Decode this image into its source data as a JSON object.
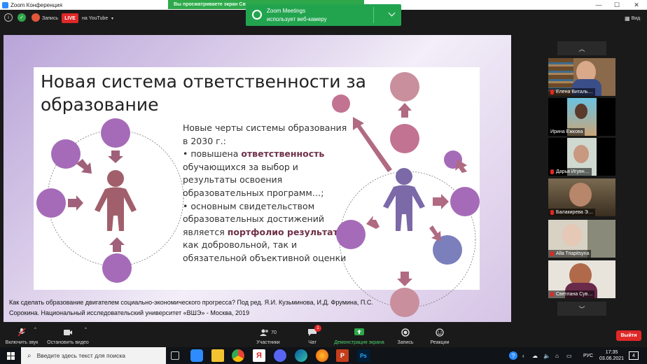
{
  "window": {
    "title": "Zoom Конференция",
    "min": "—",
    "max": "☐",
    "close": "✕"
  },
  "topbar": {
    "record_label": "Запись",
    "live_label": "LIVE",
    "youtube_label": "на YouTube",
    "share_banner": "Вы просматриваете экран Св",
    "view_label": "Вид"
  },
  "toast": {
    "line1": "Zoom Meetings",
    "line2": "использует веб-камеру"
  },
  "slide": {
    "title": "Новая система ответственности за образование",
    "text_intro": "Новые черты системы образования в 2030 г.:",
    "bullet1_pre": "• повышена ",
    "bullet1_hl": "ответственность",
    "bullet1_post": " обучающихся за выбор и результаты освоения образовательных программ…;",
    "bullet2_pre": "• основным свидетельством образовательных достижений является ",
    "bullet2_hl": "портфолио результатов",
    "bullet2_post": " как добровольной, так и обязательной объективной оценки",
    "source": "Как сделать образование двигателем социально-экономического прогресса? Под ред. Я.И. Кузьминова, И.Д. Фрумина, П.С. Сорокина. Национальный исследовательский университет «ВШЭ» - Москва, 2019",
    "colors": {
      "left_circles": "#a56bb8",
      "left_person": "#a15f6c",
      "right_person": "#7b69a8",
      "arrow_left": "#a0607a",
      "arrow_right": "#b06a82"
    }
  },
  "participants": [
    {
      "name": "Елена Виталь…",
      "muted": true
    },
    {
      "name": "Ирина Ежкова",
      "muted": false
    },
    {
      "name": "Дарья Игуян…",
      "muted": true
    },
    {
      "name": "Балакирева Э…",
      "muted": true
    },
    {
      "name": "Alla Triapitsyna",
      "muted": true
    },
    {
      "name": "Светлана Сув…",
      "muted": true
    }
  ],
  "toolbar": {
    "audio": "Включить звук",
    "video": "Остановить видео",
    "participants": "Участники",
    "participants_count": "70",
    "chat": "Чат",
    "chat_badge": "1",
    "share": "Демонстрация экрана",
    "record": "Запись",
    "reactions": "Реакции",
    "exit": "Выйти"
  },
  "taskbar": {
    "search_placeholder": "Введите здесь текст для поиска",
    "lang": "РУС",
    "time": "17:35",
    "date": "03.06.2021",
    "notif_count": "4"
  }
}
